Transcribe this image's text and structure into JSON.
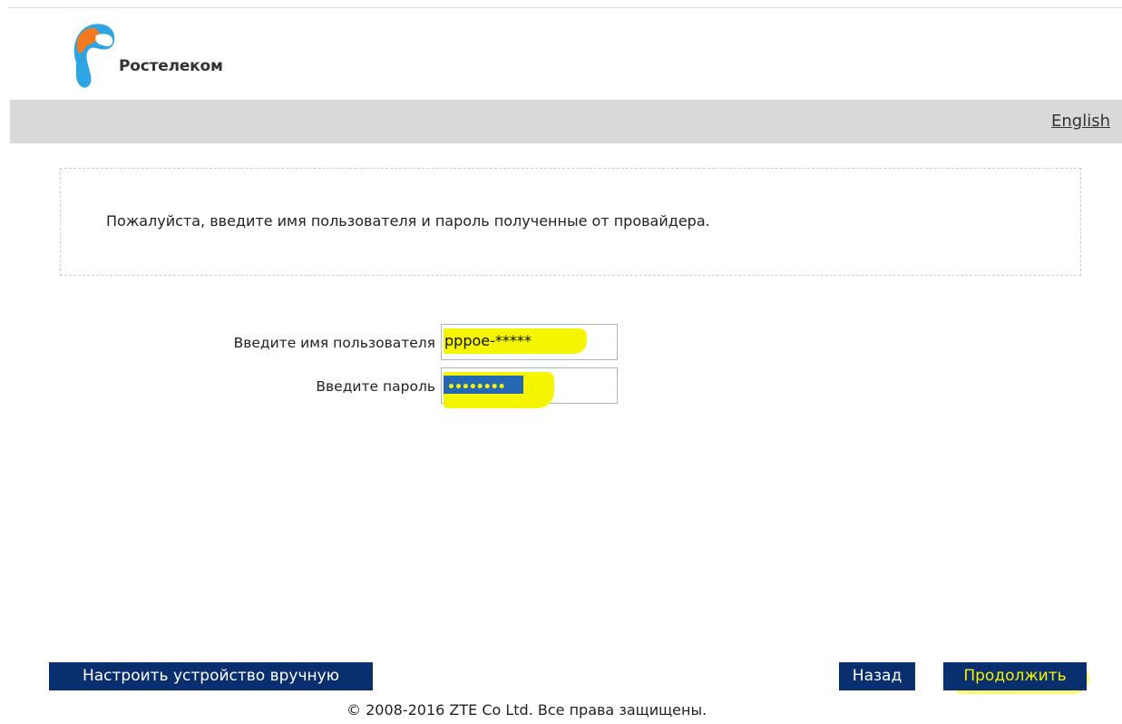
{
  "header": {
    "brand": "Ростелеком",
    "language_link": "English"
  },
  "info": {
    "message": "Пожалуйста, введите имя пользователя и пароль полученные от провайдера."
  },
  "form": {
    "username_label": "Введите имя пользователя",
    "username_value": "pppoe-*****",
    "password_label": "Введите пароль",
    "password_value": "••••••••"
  },
  "buttons": {
    "manual_setup": "Настроить устройство вручную",
    "back": "Назад",
    "continue": "Продолжить"
  },
  "footer": {
    "copyright": "© 2008-2016 ZTE Co Ltd. Все права защищены."
  },
  "colors": {
    "button_bg": "#0a2f6e",
    "bar_bg": "#d9d9d9",
    "highlight": "#f5f500",
    "logo_blue": "#2ea4e3",
    "logo_orange": "#f47a20"
  }
}
